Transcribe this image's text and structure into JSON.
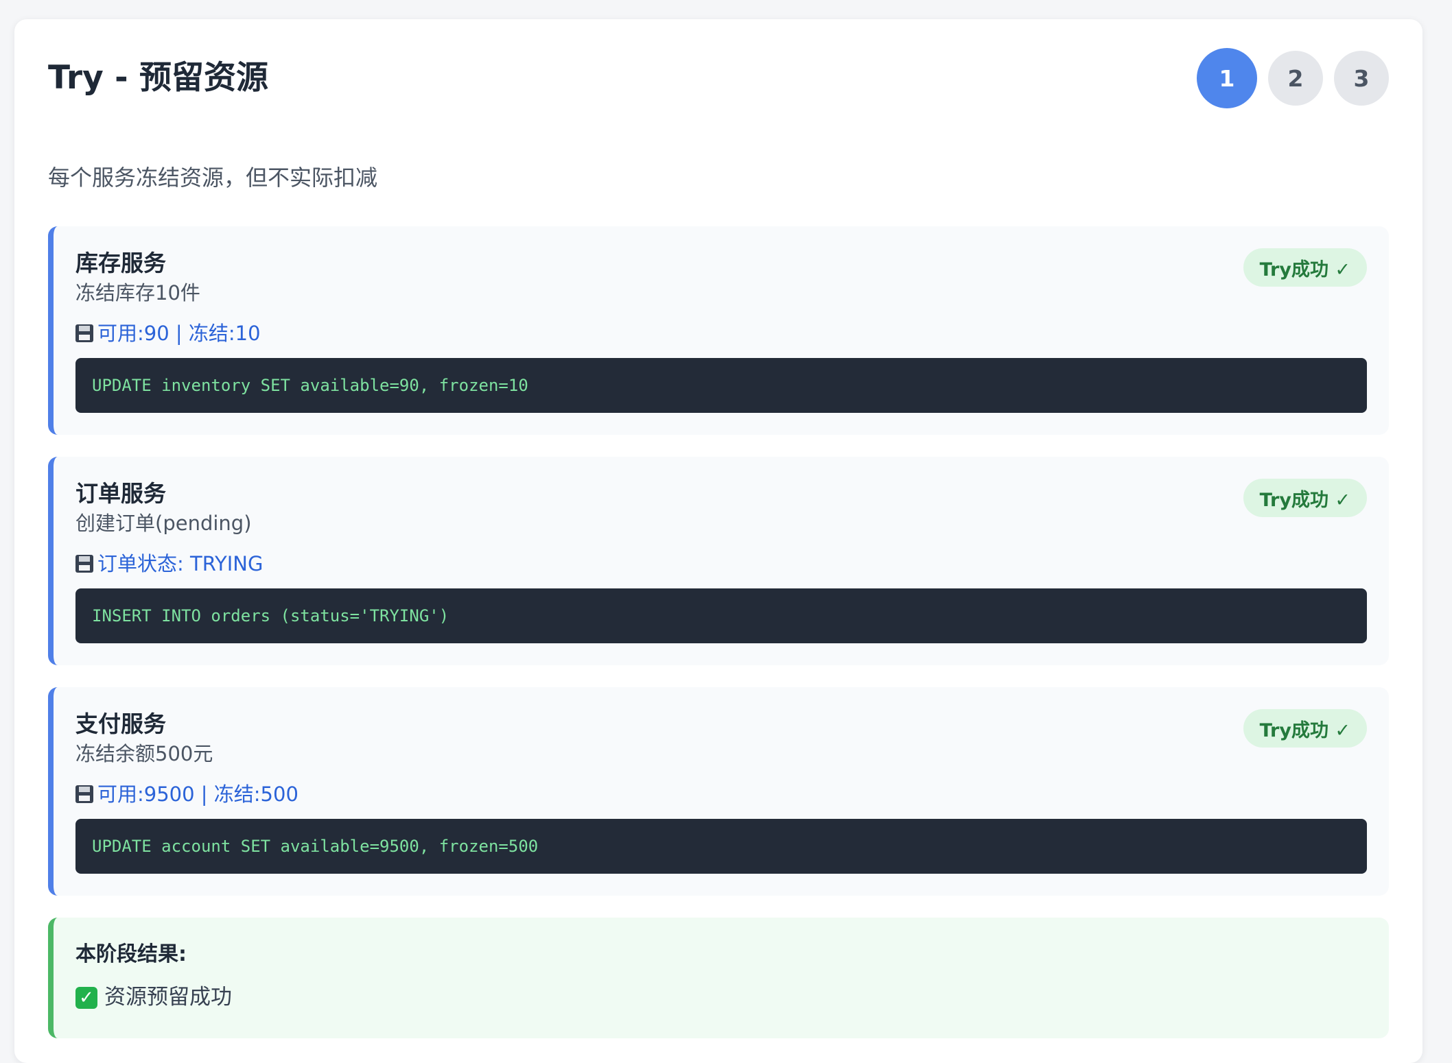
{
  "header": {
    "title": "Try - 预留资源",
    "steps": [
      "1",
      "2",
      "3"
    ],
    "active_step": "1"
  },
  "subtitle": "每个服务冻结资源，但不实际扣减",
  "services": [
    {
      "name": "库存服务",
      "desc": "冻结库存10件",
      "state": "可用:90 | 冻结:10",
      "sql": "UPDATE inventory SET available=90, frozen=10",
      "badge": "Try成功 ✓"
    },
    {
      "name": "订单服务",
      "desc": "创建订单(pending)",
      "state": "订单状态: TRYING",
      "sql": "INSERT INTO orders (status='TRYING')",
      "badge": "Try成功 ✓"
    },
    {
      "name": "支付服务",
      "desc": "冻结余额500元",
      "state": "可用:9500 | 冻结:500",
      "sql": "UPDATE account SET available=9500, frozen=500",
      "badge": "Try成功 ✓"
    }
  ],
  "result": {
    "title": "本阶段结果:",
    "item": "资源预留成功"
  },
  "icons": {
    "state_icon": "floppy-disk-icon",
    "result_icon": "check-mark-icon"
  },
  "colors": {
    "accent": "#4f86ec",
    "service_border": "#4f7fe8",
    "success_border": "#4cb866",
    "badge_bg": "#ddf5e3",
    "badge_text": "#247a3c",
    "code_bg": "#232b38",
    "code_text": "#7ee2a0"
  }
}
